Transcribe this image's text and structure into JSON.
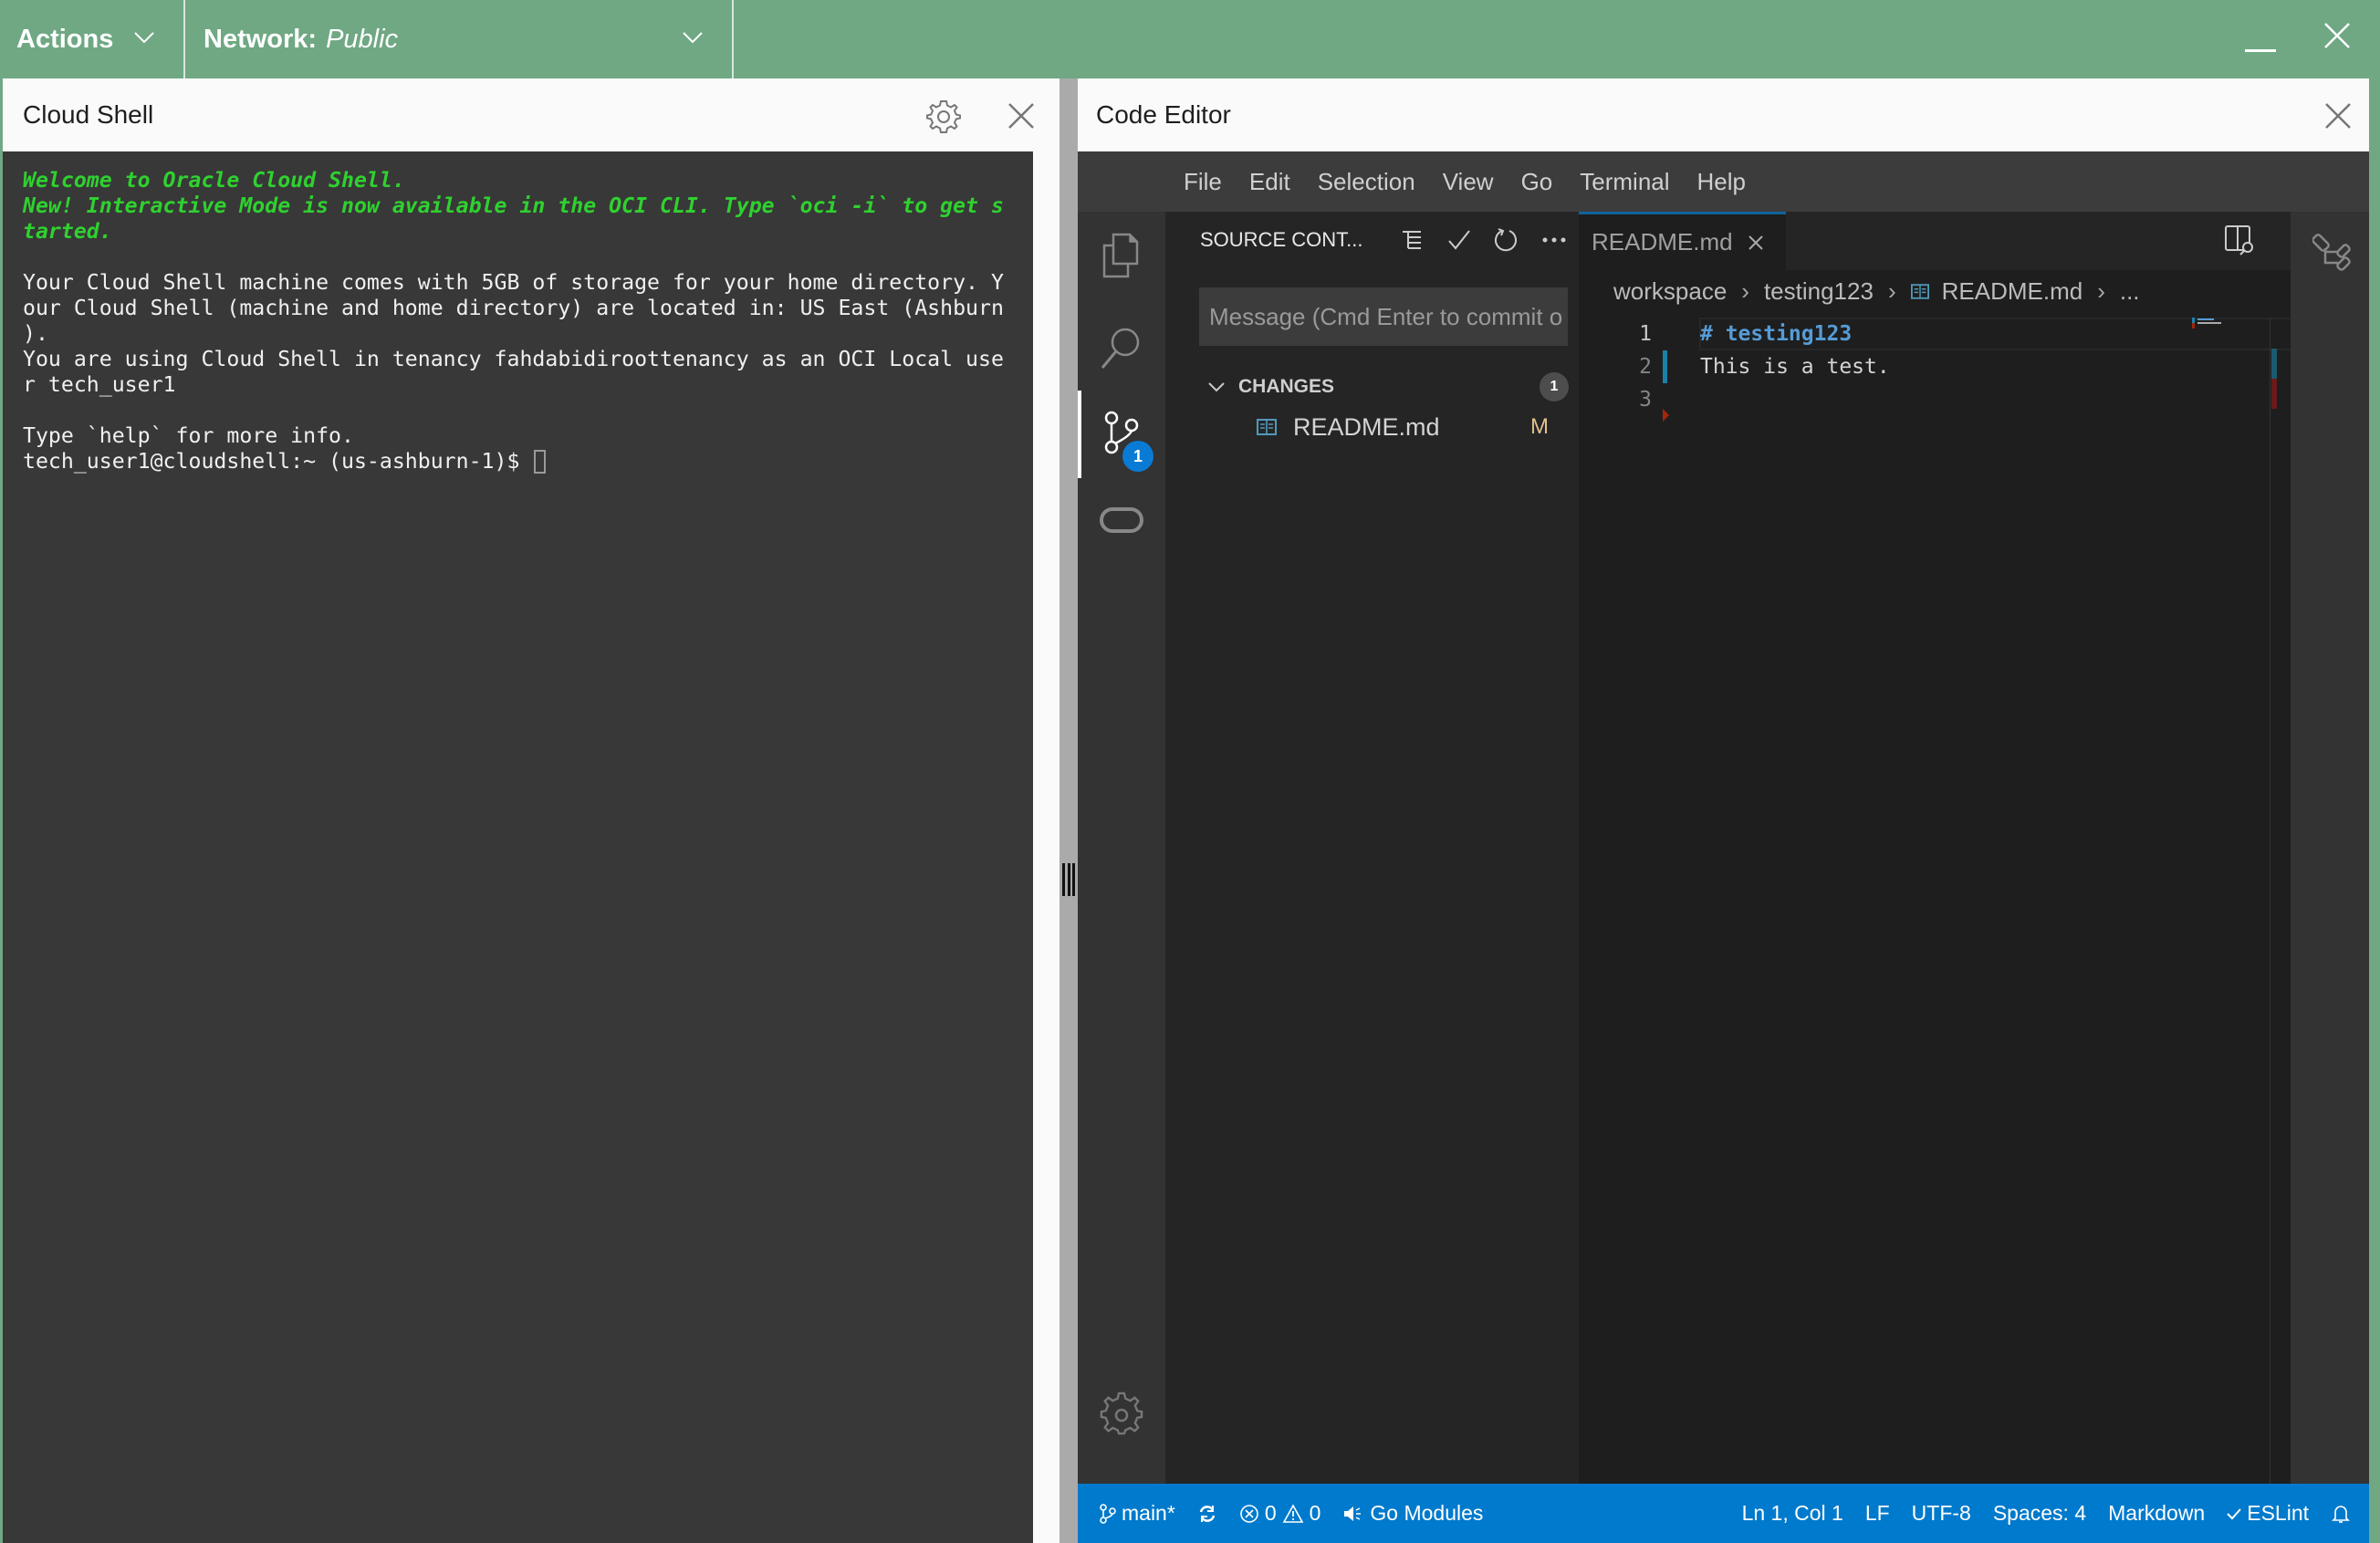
{
  "topbar": {
    "actions_label": "Actions",
    "network_label": "Network:",
    "network_value": "Public",
    "colors": {
      "background": "#6fa883"
    }
  },
  "cloud_shell": {
    "title": "Cloud Shell",
    "terminal": {
      "welcome_line1": "Welcome to Oracle Cloud Shell.",
      "welcome_line2": "New! Interactive Mode is now available in the OCI CLI. Type `oci -i` to get s",
      "welcome_line3": "tarted.",
      "info_line1": "Your Cloud Shell machine comes with 5GB of storage for your home directory. Y",
      "info_line2": "our Cloud Shell (machine and home directory) are located in: US East (Ashburn",
      "info_line3": ").",
      "info_line4": "You are using Cloud Shell in tenancy fahdabidiroottenancy as an OCI Local use",
      "info_line5": "r tech_user1",
      "help_line": "Type `help` for more info.",
      "prompt": "tech_user1@cloudshell:~ (us-ashburn-1)$ "
    }
  },
  "code_editor": {
    "title": "Code Editor",
    "menu": [
      "File",
      "Edit",
      "Selection",
      "View",
      "Go",
      "Terminal",
      "Help"
    ],
    "activity_bar": {
      "items": [
        "explorer-icon",
        "search-icon",
        "source-control-icon",
        "remote-icon"
      ],
      "source_control_badge": "1",
      "bottom": "manage-gear-icon"
    },
    "source_control": {
      "title": "SOURCE CONT...",
      "message_placeholder": "Message (Cmd Enter to commit o",
      "changes_label": "CHANGES",
      "changes_count": "1",
      "files": [
        {
          "name": "README.md",
          "status": "M"
        }
      ]
    },
    "tab": {
      "label": "README.md"
    },
    "breadcrumb": [
      "workspace",
      "testing123",
      "README.md",
      "..."
    ],
    "lines": [
      {
        "number": "1",
        "text": "# testing123"
      },
      {
        "number": "2",
        "text": "This is a test."
      },
      {
        "number": "3",
        "text": ""
      }
    ],
    "status_bar": {
      "branch": "main*",
      "errors": "0",
      "warnings": "0",
      "go_modules": "Go Modules",
      "position": "Ln 1, Col 1",
      "eol": "LF",
      "encoding": "UTF-8",
      "indent": "Spaces: 4",
      "language": "Markdown",
      "eslint": "ESLint",
      "colors": {
        "background": "#007acc"
      }
    }
  }
}
